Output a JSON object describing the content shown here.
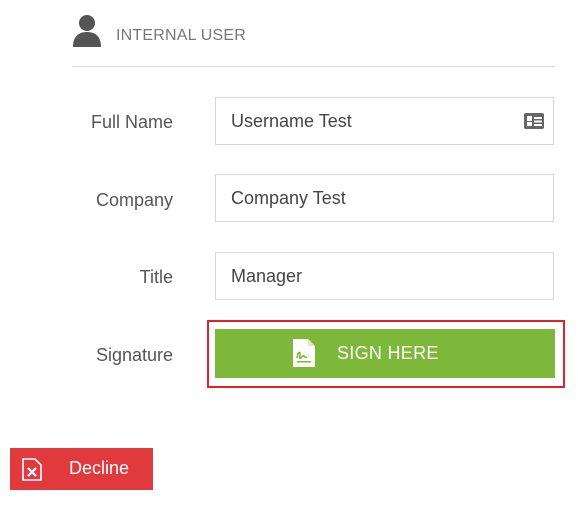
{
  "header": {
    "icon": "user-icon",
    "title": "INTERNAL USER"
  },
  "form": {
    "full_name": {
      "label": "Full Name",
      "value": "Username Test",
      "icon": "id-card-icon"
    },
    "company": {
      "label": "Company",
      "value": "Company Test"
    },
    "title": {
      "label": "Title",
      "value": "Manager"
    },
    "signature": {
      "label": "Signature",
      "button_label": "SIGN HERE",
      "button_icon": "signature-document-icon"
    }
  },
  "actions": {
    "decline_label": "Decline",
    "decline_icon": "decline-document-icon"
  },
  "colors": {
    "sign_button": "#7db83a",
    "decline_button": "#e03a3e",
    "highlight_border": "#e0202a",
    "field_border": "#d6d6d6",
    "header_rule": "#d9d9d9",
    "label_text": "#555555"
  }
}
